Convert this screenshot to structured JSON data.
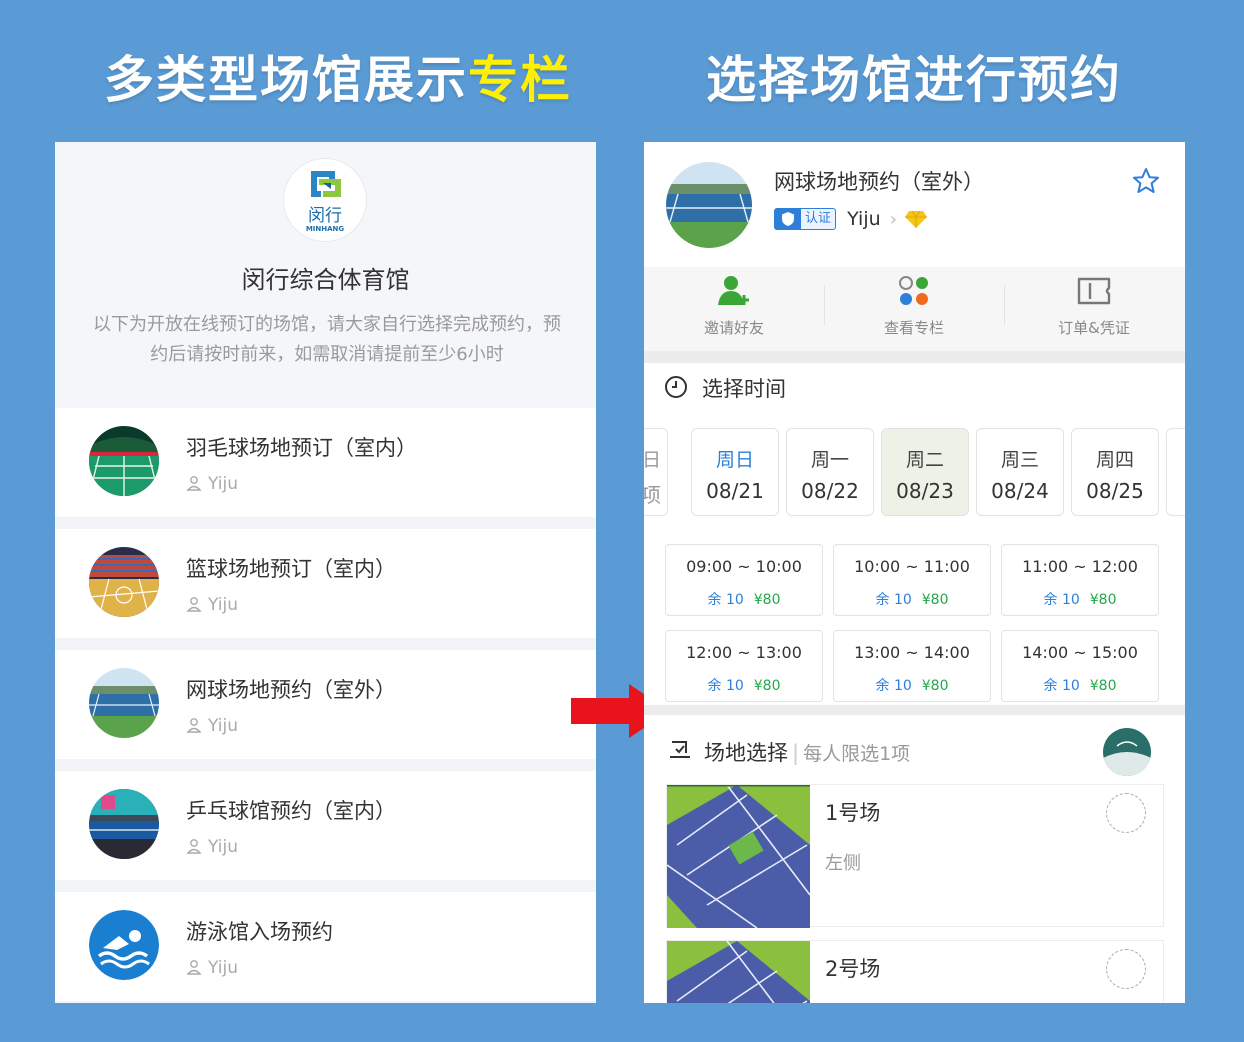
{
  "headlines": {
    "left_main": "多类型场馆展示",
    "left_highlight": "专栏",
    "right": "选择场馆进行预约"
  },
  "venue": {
    "logo_cn": "闵行",
    "logo_en": "MINHANG",
    "name": "闵行综合体育馆",
    "description": "以下为开放在线预订的场馆，请大家自行选择完成预约，预约后请按时前来，如需取消请提前至少6小时"
  },
  "court_list": [
    {
      "title": "羽毛球场地预订（室内）",
      "owner": "Yiju"
    },
    {
      "title": "篮球场地预订（室内）",
      "owner": "Yiju"
    },
    {
      "title": "网球场地预约（室外）",
      "owner": "Yiju"
    },
    {
      "title": "乒乓球馆预约（室内）",
      "owner": "Yiju"
    },
    {
      "title": "游泳馆入场预约",
      "owner": "Yiju"
    }
  ],
  "booking": {
    "title": "网球场地预约（室外）",
    "cert_label": "认证",
    "owner": "Yiju",
    "actions": [
      {
        "label": "邀请好友",
        "icon": "add-user-icon"
      },
      {
        "label": "查看专栏",
        "icon": "apps-icon"
      },
      {
        "label": "订单&凭证",
        "icon": "ticket-icon"
      }
    ],
    "time_section_label": "选择时间",
    "partial_date_week": "日",
    "partial_date_day": "项",
    "dates": [
      {
        "week": "周日",
        "date": "08/21"
      },
      {
        "week": "周一",
        "date": "08/22"
      },
      {
        "week": "周二",
        "date": "08/23"
      },
      {
        "week": "周三",
        "date": "08/24"
      },
      {
        "week": "周四",
        "date": "08/25"
      }
    ],
    "slots": [
      {
        "time": "09:00 ~ 10:00",
        "remaining": "余 10",
        "price": "¥80"
      },
      {
        "time": "10:00 ~ 11:00",
        "remaining": "余 10",
        "price": "¥80"
      },
      {
        "time": "11:00 ~ 12:00",
        "remaining": "余 10",
        "price": "¥80"
      },
      {
        "time": "12:00 ~ 13:00",
        "remaining": "余 10",
        "price": "¥80"
      },
      {
        "time": "13:00 ~ 14:00",
        "remaining": "余 10",
        "price": "¥80"
      },
      {
        "time": "14:00 ~ 15:00",
        "remaining": "余 10",
        "price": "¥80"
      }
    ],
    "field_section_label": "场地选择",
    "field_section_note": "每人限选1项",
    "fields": [
      {
        "name": "1号场",
        "side": "左侧"
      },
      {
        "name": "2号场",
        "side": ""
      }
    ]
  },
  "colors": {
    "background": "#5b9bd5",
    "highlight_yellow": "#ffef00",
    "accent_blue": "#2e7fd8",
    "price_green": "#22a84a",
    "arrow_red": "#e8131b"
  }
}
